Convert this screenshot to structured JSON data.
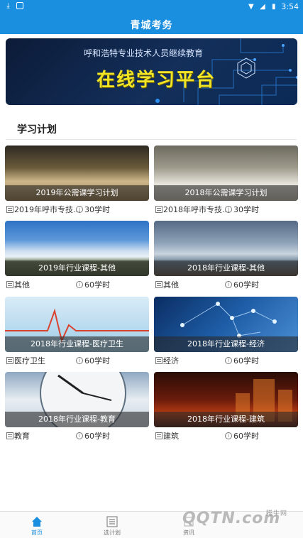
{
  "status_bar": {
    "time": "3:54",
    "left_icons": [
      "download-icon",
      "notification-icon"
    ],
    "right_icons": [
      "wifi-icon",
      "signal-icon",
      "battery-icon"
    ]
  },
  "app_bar": {
    "title": "青城考务"
  },
  "banner": {
    "subtitle": "呼和浩特专业技术人员继续教育",
    "headline": "在线学习平台"
  },
  "section": {
    "title": "学习计划"
  },
  "courses": [
    {
      "title": "2019年公需课学习计划",
      "category": "2019年呼市专技...",
      "hours": "30学时"
    },
    {
      "title": "2018年公需课学习计划",
      "category": "2018年呼市专技...",
      "hours": "30学时"
    },
    {
      "title": "2019年行业课程-其他",
      "category": "其他",
      "hours": "60学时"
    },
    {
      "title": "2018年行业课程-其他",
      "category": "其他",
      "hours": "60学时"
    },
    {
      "title": "2018年行业课程-医疗卫生",
      "category": "医疗卫生",
      "hours": "60学时"
    },
    {
      "title": "2018年行业课程-经济",
      "category": "经济",
      "hours": "60学时"
    },
    {
      "title": "2018年行业课程-教育",
      "category": "教育",
      "hours": "60学时"
    },
    {
      "title": "2018年行业课程-建筑",
      "category": "建筑",
      "hours": "60学时"
    }
  ],
  "tabs": [
    {
      "label": "首页",
      "icon": "home-icon",
      "active": true
    },
    {
      "label": "选计划",
      "icon": "plan-list-icon",
      "active": false
    },
    {
      "label": "资讯",
      "icon": "news-icon",
      "active": false
    }
  ],
  "watermark": {
    "text": "QQTN.com",
    "small": "腾牛网"
  },
  "colors": {
    "primary": "#1a8fe0",
    "banner_text": "#f2e526"
  }
}
